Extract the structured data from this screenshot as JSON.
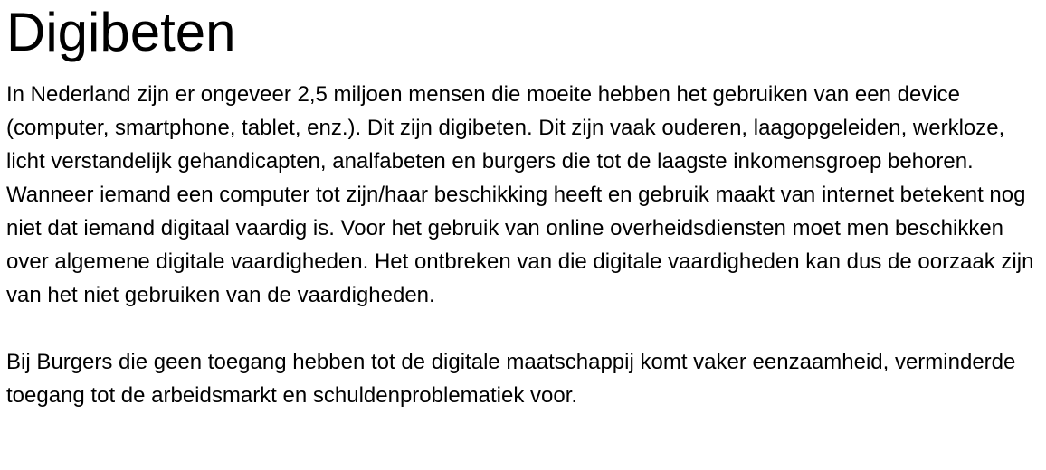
{
  "document": {
    "title": "Digibeten",
    "paragraphs": [
      "In Nederland zijn er ongeveer 2,5 miljoen mensen die moeite hebben het gebruiken van een device (computer, smartphone, tablet, enz.). Dit zijn digibeten. Dit zijn vaak ouderen, laagopgeleiden, werkloze, licht verstandelijk gehandicapten, analfabeten en burgers die tot de laagste inkomensgroep behoren. Wanneer iemand een computer tot zijn/haar beschikking heeft en gebruik maakt van internet betekent nog niet dat iemand digitaal vaardig is. Voor het gebruik van online overheidsdiensten moet men beschikken over algemene digitale vaardigheden. Het ontbreken van die digitale vaardigheden kan dus de oorzaak zijn van het niet gebruiken van de vaardigheden.",
      "Bij Burgers die geen toegang hebben tot de digitale maatschappij komt vaker eenzaamheid, verminderde toegang tot de arbeidsmarkt en schuldenproblematiek voor."
    ]
  }
}
